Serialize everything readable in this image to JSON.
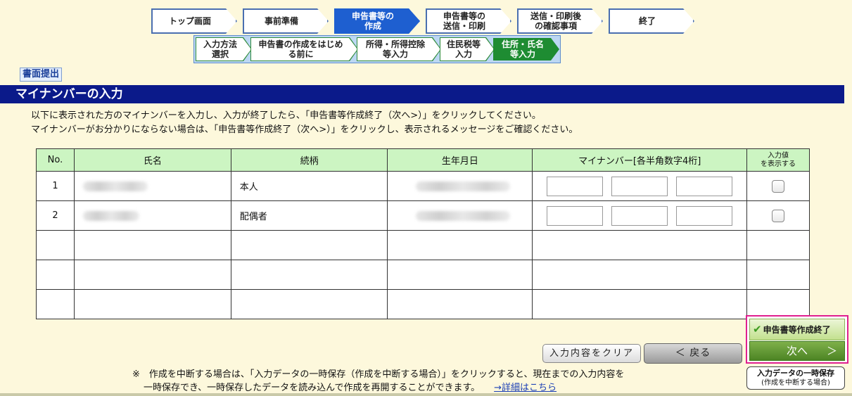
{
  "steps_main": [
    {
      "label": "トップ画面",
      "active": false
    },
    {
      "label": "事前準備",
      "active": false
    },
    {
      "label": "申告書等の\n作成",
      "active": true
    },
    {
      "label": "申告書等の\n送信・印刷",
      "active": false
    },
    {
      "label": "送信・印刷後\nの確認事項",
      "active": false
    },
    {
      "label": "終了",
      "active": false
    }
  ],
  "steps_sub": [
    {
      "label": "入力方法\n選択",
      "active": false
    },
    {
      "label": "申告書の作成をはじめ\nる前に",
      "active": false
    },
    {
      "label": "所得・所得控除\n等入力",
      "active": false
    },
    {
      "label": "住民税等\n入力",
      "active": false
    },
    {
      "label": "住所・氏名\n等入力",
      "active": true
    }
  ],
  "header": {
    "paper_button": "書面提出",
    "title": "マイナンバーの入力"
  },
  "instructions": [
    "以下に表示された方のマイナンバーを入力し、入力が終了したら、「申告書等作成終了（次へ>）」をクリックしてください。",
    "マイナンバーがお分かりにならない場合は、「申告書等作成終了（次へ>）」をクリックし、表示されるメッセージをご確認ください。"
  ],
  "table": {
    "headers": {
      "no": "No.",
      "name": "氏名",
      "relation": "続柄",
      "birthdate": "生年月日",
      "mynumber": "マイナンバー[各半角数字4桁]",
      "show_value": "入力値\nを表示する"
    },
    "rows": [
      {
        "no": "1",
        "relation": "本人"
      },
      {
        "no": "2",
        "relation": "配偶者"
      }
    ]
  },
  "buttons": {
    "clear": "入力内容をクリア",
    "back": "＜ 戻る",
    "finish_title": "申告書等作成終了",
    "next": "次へ",
    "next_arrow": "＞",
    "temp_save": "入力データの一時保存",
    "temp_save_sub": "(作成を中断する場合)"
  },
  "note": {
    "line1": "※　作成を中断する場合は、「入力データの一時保存（作成を中断する場合）」をクリックすると、現在までの入力内容を",
    "line2": "一時保存でき、一時保存したデータを読み込んで作成を再開することができます。",
    "link": "→詳細はこちら"
  },
  "colors": {
    "page_bg": "#FDF8DC",
    "title_bar": "#0b1a8a",
    "active_step": "#1e5fd0",
    "active_substep": "#1e8c32",
    "table_header": "#ccf5c2",
    "highlight_border": "#e0208f"
  }
}
